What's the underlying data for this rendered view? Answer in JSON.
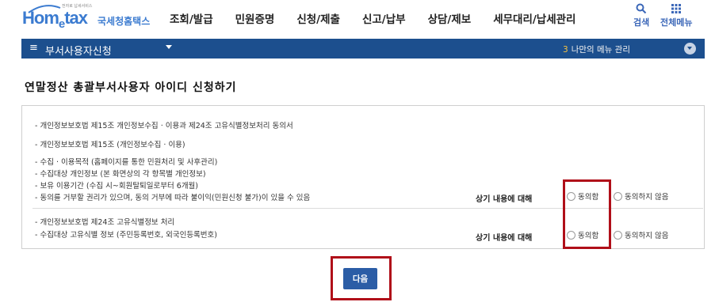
{
  "header": {
    "logo_tagline": "전자로 납세서비스",
    "logo_brand_a": "Hom",
    "logo_brand_e": "e",
    "logo_brand_b": "tax",
    "logo_brand_kr": "국세청홈택스",
    "nav": [
      "조회/발급",
      "민원증명",
      "신청/제출",
      "신고/납부",
      "상담/제보",
      "세무대리/납세관리"
    ],
    "search_label": "검색",
    "allmenu_label": "전체메뉴",
    "search_icon": "search-icon",
    "allmenu_icon": "grid-icon"
  },
  "menubar": {
    "hamburger": "≡",
    "title": "부서사용자신청",
    "my_menu_num": "3",
    "my_menu_label": "나만의 메뉴 관리"
  },
  "page": {
    "title": "연말정산 총괄부서사용자 아이디 신청하기"
  },
  "consent": {
    "section1_lines": [
      "- 개인정보보호법 제15조 개인정보수집 · 이용과 제24조 고유식별정보처리 동의서",
      "- 개인정보보호법 제15조 (개인정보수집 · 이용)",
      "- 수집 · 이용목적 (홈페이지를 통한 민원처리 및 사후관리)",
      "- 수집대상 개인정보 (본 화면상의 각 항목별 개인정보)",
      "- 보유 이용기간 (수집 시~회원탈퇴일로부터 6개월)",
      "- 동의를 거부할 권리가 있으며, 동의 거부에 따라 불이익(민원신청 불가)이 있을 수 있음"
    ],
    "section2_lines": [
      "- 개인정보보호법 제24조 고유식별정보 처리",
      "- 수집대상 고유식별 정보 (주민등록번호, 외국인등록번호)"
    ],
    "ask_label": "상기 내용에 대해",
    "agree_label": "동의함",
    "disagree_label": "동의하지 않음"
  },
  "actions": {
    "next_label": "다음"
  },
  "colors": {
    "brand_blue": "#3b7bd0",
    "menubar_bg": "#1c4f8e",
    "highlight_red": "#b00f19",
    "button_blue": "#2b5da6"
  }
}
